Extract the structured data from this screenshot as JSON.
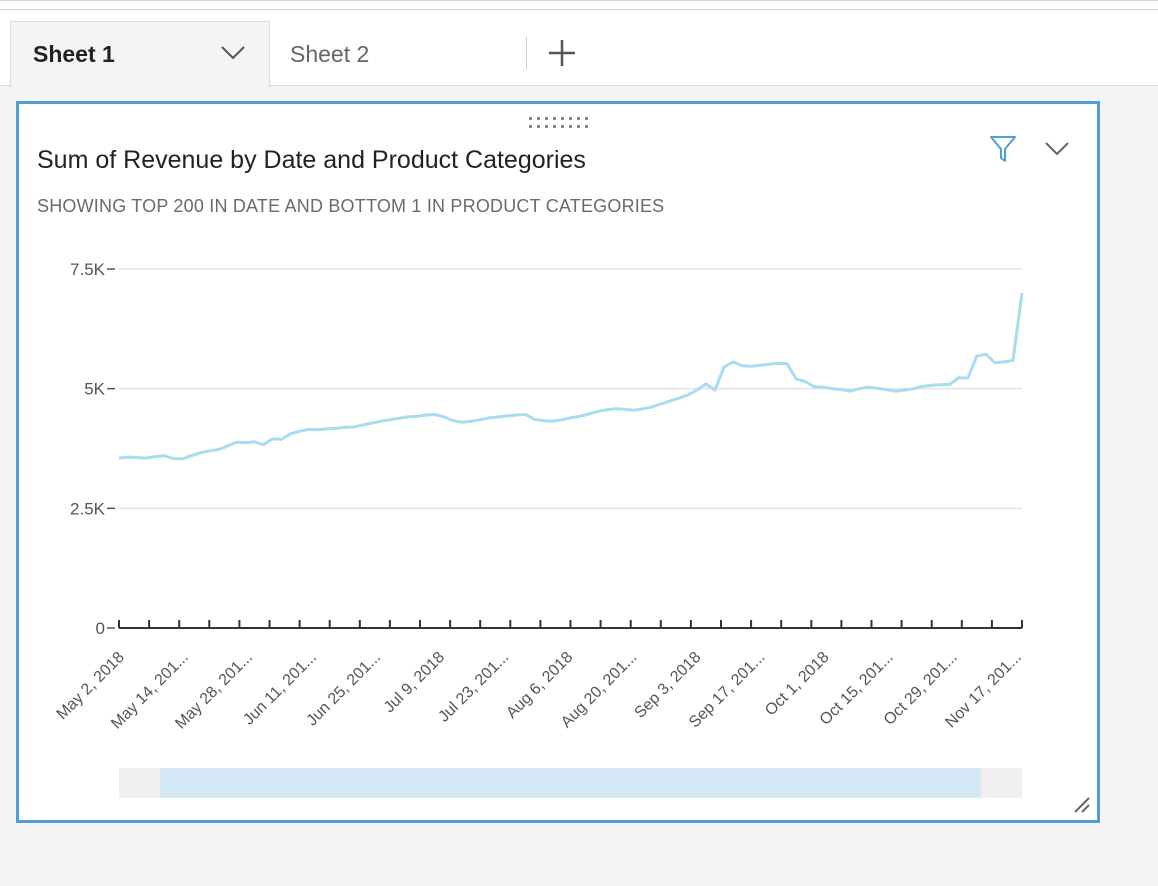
{
  "tabs": [
    {
      "label": "Sheet 1",
      "active": true
    },
    {
      "label": "Sheet 2",
      "active": false
    }
  ],
  "widget": {
    "title": "Sum of Revenue by Date and Product Categories",
    "subtitle": "SHOWING TOP 200 IN DATE AND BOTTOM 1 IN PRODUCT CATEGORIES",
    "icons": [
      "drag-handle-icon",
      "filter-icon",
      "chevron-down-icon",
      "resize-icon"
    ],
    "accent_color": "#4d9fd4"
  },
  "chart_data": {
    "type": "line",
    "title": "Sum of Revenue by Date and Product Categories",
    "ylim": [
      0,
      7500
    ],
    "y_ticks": [
      {
        "value": 0,
        "label": "0"
      },
      {
        "value": 2500,
        "label": "2.5K"
      },
      {
        "value": 5000,
        "label": "5K"
      },
      {
        "value": 7500,
        "label": "7.5K"
      }
    ],
    "x_tick_labels": [
      "May 2, 2018",
      "May 14, 201...",
      "May 28, 201...",
      "Jun 11, 201...",
      "Jun 25, 201...",
      "Jul 9, 2018",
      "Jul 23, 201...",
      "Aug 6, 2018",
      "Aug 20, 201...",
      "Sep 3, 2018",
      "Sep 17, 201...",
      "Oct 1, 2018",
      "Oct 15, 201...",
      "Oct 29, 201...",
      "Nov 17, 201..."
    ],
    "grid": true,
    "line_color": "#a8dcf0",
    "series": [
      {
        "values": [
          3550,
          3570,
          3560,
          3550,
          3580,
          3600,
          3540,
          3530,
          3600,
          3660,
          3700,
          3730,
          3800,
          3880,
          3870,
          3890,
          3830,
          3950,
          3940,
          4060,
          4110,
          4150,
          4140,
          4160,
          4170,
          4190,
          4200,
          4240,
          4280,
          4320,
          4350,
          4380,
          4410,
          4420,
          4450,
          4460,
          4410,
          4330,
          4300,
          4320,
          4350,
          4390,
          4410,
          4430,
          4450,
          4460,
          4360,
          4330,
          4320,
          4350,
          4390,
          4420,
          4470,
          4520,
          4560,
          4580,
          4570,
          4550,
          4580,
          4620,
          4680,
          4740,
          4800,
          4870,
          4970,
          5100,
          4970,
          5450,
          5560,
          5480,
          5470,
          5490,
          5510,
          5530,
          5520,
          5200,
          5150,
          5040,
          5030,
          5000,
          4980,
          4950,
          5000,
          5030,
          5010,
          4980,
          4950,
          4970,
          5000,
          5050,
          5070,
          5080,
          5090,
          5230,
          5220,
          5680,
          5720,
          5540,
          5560,
          5590,
          7000
        ]
      }
    ]
  },
  "scrollbar": {
    "start": 0.045,
    "end": 0.955
  }
}
